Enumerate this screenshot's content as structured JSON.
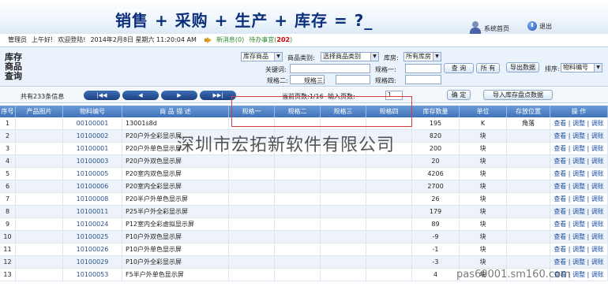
{
  "banner": {
    "title": "销售 + 采购 + 生产 + 库存 = ?_",
    "home_label": "系统首页",
    "exit_label": "退出"
  },
  "status": {
    "user": "管理员",
    "greeting": "上午好!",
    "welcome": "欢迎登陆!",
    "datetime": "2014年2月8日 星期六  11:20:04 AM",
    "new_msg": "新消息(0)",
    "todo_label": "待办事宜(",
    "todo_count": "202",
    "todo_close": ")"
  },
  "search": {
    "title": "库存商品查询",
    "scope_select": "库存商品",
    "category_label": "商品类别:",
    "category_select": "选择商品类别",
    "warehouse_label": "库房:",
    "warehouse_select": "所有库房",
    "keyword_label": "关键词:",
    "spec1_label": "规格一:",
    "spec2_label": "规格二:",
    "spec3_label": "规格三:",
    "spec4_label": "规格四:",
    "query_button": "查 询",
    "all_button": "所 有",
    "export_button": "导出数据",
    "sort_label": "排序:",
    "sort_select": "物料编号"
  },
  "pager": {
    "total": "共有233条信息",
    "first": "|◀◀",
    "prev": "◀",
    "next": "▶",
    "last": "▶▶|",
    "current": "当前页数:1/16",
    "goto_label": "输入页数:",
    "goto_value": "1",
    "confirm": "确 定",
    "import": "导入库存盘点数据"
  },
  "table": {
    "headers": [
      "序号",
      "产品图片",
      "物料编号",
      "商 品 描 述",
      "规格一",
      "规格二",
      "规格三",
      "规格四",
      "库存数量",
      "单位",
      "存放位置",
      "操 作"
    ],
    "actions": "查看 | 调整 | 调账",
    "rows": [
      {
        "no": "1",
        "code": "00100001",
        "desc": "13001s8d",
        "qty": "195",
        "unit": "K",
        "loc": "角落"
      },
      {
        "no": "2",
        "code": "10100002",
        "desc": "P20户外全彩显示屏",
        "qty": "820",
        "unit": "块",
        "loc": ""
      },
      {
        "no": "3",
        "code": "10100001",
        "desc": "P20户外单色显示屏",
        "qty": "200",
        "unit": "块",
        "loc": ""
      },
      {
        "no": "4",
        "code": "10100003",
        "desc": "P20户外双色显示屏",
        "qty": "20",
        "unit": "块",
        "loc": ""
      },
      {
        "no": "5",
        "code": "10100005",
        "desc": "P20室内双色显示屏",
        "qty": "4206",
        "unit": "块",
        "loc": ""
      },
      {
        "no": "6",
        "code": "10100006",
        "desc": "P20室内全彩显示屏",
        "qty": "2700",
        "unit": "块",
        "loc": ""
      },
      {
        "no": "7",
        "code": "10100008",
        "desc": "P20半户外单色显示屏",
        "qty": "26",
        "unit": "块",
        "loc": ""
      },
      {
        "no": "8",
        "code": "10100011",
        "desc": "P25半户外全彩显示屏",
        "qty": "179",
        "unit": "块",
        "loc": ""
      },
      {
        "no": "9",
        "code": "10100024",
        "desc": "P12室内全彩虚拟显示屏",
        "qty": "89",
        "unit": "块",
        "loc": ""
      },
      {
        "no": "10",
        "code": "10100025",
        "desc": "P10户外双色显示屏",
        "qty": "-9",
        "unit": "块",
        "loc": ""
      },
      {
        "no": "11",
        "code": "10100026",
        "desc": "P10户外单色显示屏",
        "qty": "-1",
        "unit": "块",
        "loc": ""
      },
      {
        "no": "12",
        "code": "10100029",
        "desc": "P10户外全彩显示屏",
        "qty": "-3",
        "unit": "块",
        "loc": ""
      },
      {
        "no": "13",
        "code": "10100053",
        "desc": "F5半户外单色显示屏",
        "qty": "4",
        "unit": "块",
        "loc": ""
      }
    ]
  },
  "watermark": "深圳市宏拓新软件有限公司",
  "watermark_url": "pas60001.sm160.com"
}
